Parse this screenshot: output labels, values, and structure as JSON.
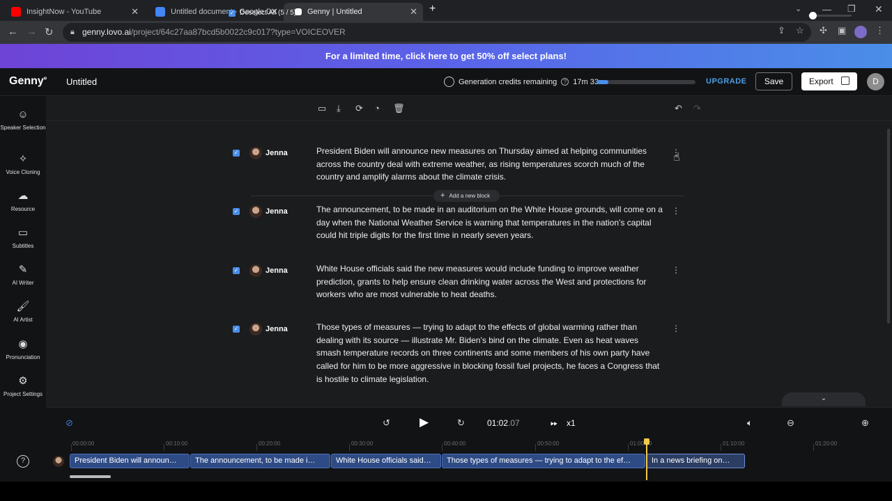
{
  "browser": {
    "tabs": [
      {
        "label": "InsightNow - YouTube",
        "favicon_color": "#ff0000"
      },
      {
        "label": "Untitled document - Google Doc",
        "favicon_color": "#4285f4"
      },
      {
        "label": "Genny | Untitled",
        "favicon_color": "#ffffff"
      }
    ],
    "url_domain": "genny.lovo.ai",
    "url_path": "/project/64c27aa87bcd5b0022c9c017?type=VOICEOVER"
  },
  "promo": {
    "text": "For a limited time, click here to get 50% off select plans!"
  },
  "header": {
    "logo": "Genny",
    "project_title": "Untitled",
    "credits_label": "Generation credits remaining",
    "credits_value": "17m 33s",
    "credits_fraction": 0.12,
    "upgrade": "UPGRADE",
    "save": "Save",
    "export": "Export",
    "avatar_initial": "D"
  },
  "sidebar": {
    "items": [
      {
        "label": "Speaker Selection",
        "icon": "speaker-selection-icon"
      },
      {
        "label": "Voice Cloning",
        "icon": "voice-cloning-icon"
      },
      {
        "label": "Resource",
        "icon": "resource-icon"
      },
      {
        "label": "Subtitles",
        "icon": "subtitles-icon"
      },
      {
        "label": "AI Writer",
        "icon": "ai-writer-icon"
      },
      {
        "label": "AI Artist",
        "icon": "ai-artist-icon"
      },
      {
        "label": "Pronunciation",
        "icon": "pronunciation-icon"
      },
      {
        "label": "Project Settings",
        "icon": "gear-icon"
      }
    ]
  },
  "toolbar": {
    "deselect_label": "Deselect All (5 / 5)"
  },
  "blocks": [
    {
      "speaker": "Jenna",
      "text": "President Biden will announce new measures on Thursday aimed at helping communities across the country deal with extreme weather, as rising temperatures scorch much of the country and amplify alarms about the climate crisis."
    },
    {
      "speaker": "Jenna",
      "text": "The announcement, to be made in an auditorium on the White House grounds, will come on a day when the National Weather Service is warning that temperatures in the nation’s capital could hit triple digits for the first time in nearly seven years."
    },
    {
      "speaker": "Jenna",
      "text": "White House officials said the new measures would include funding to improve weather prediction, grants to help ensure clean drinking water across the West and protections for workers who are most vulnerable to heat deaths."
    },
    {
      "speaker": "Jenna",
      "text": "Those types of measures — trying to adapt to the effects of global warming rather than dealing with its source — illustrate Mr. Biden’s bind on the climate. Even as heat waves smash temperature records on three continents and some members of his own party have called for him to be more aggressive in blocking fossil fuel projects, he faces a Congress that is hostile to climate legislation."
    }
  ],
  "add_block_label": "Add a new block",
  "player": {
    "time_main": "01:02",
    "time_ms": ".07",
    "speed": "x1"
  },
  "timeline": {
    "ticks": [
      "00:00:00",
      "00:10:00",
      "00:20:00",
      "00:30:00",
      "00:40:00",
      "00:50:00",
      "01:00:00",
      "01:10:00",
      "01:20:00"
    ],
    "clips": [
      "President Biden will announ…",
      "The announcement, to be made i…",
      "White House officials said…",
      "Those types of measures — trying to adapt to the ef…",
      "In a news briefing on…"
    ]
  }
}
